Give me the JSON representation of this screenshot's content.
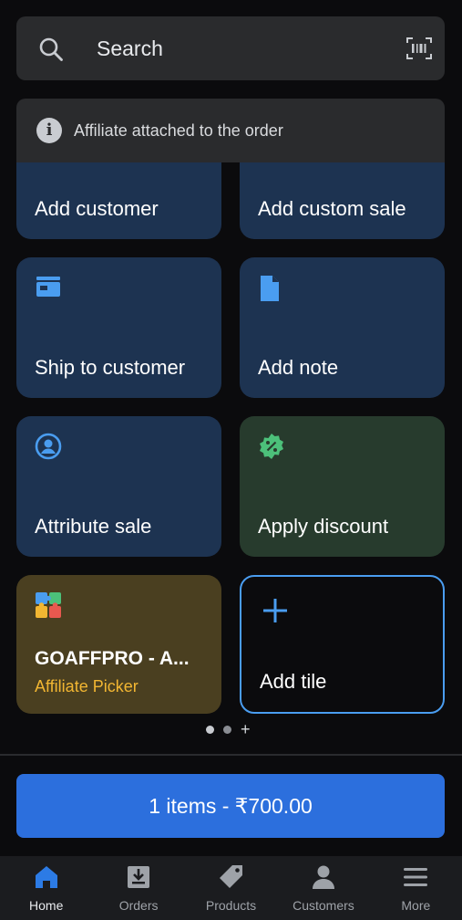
{
  "search": {
    "label": "Search",
    "icon": "search-icon",
    "scan_icon": "barcode-scan-icon"
  },
  "banner": {
    "text": "Affiliate attached to the order",
    "icon": "info-icon"
  },
  "tiles": {
    "add_customer": {
      "label": "Add customer"
    },
    "add_custom_sale": {
      "label": "Add custom sale"
    },
    "ship_to_customer": {
      "label": "Ship to customer",
      "icon": "store-icon"
    },
    "add_note": {
      "label": "Add note",
      "icon": "note-icon"
    },
    "attribute_sale": {
      "label": "Attribute sale",
      "icon": "user-circle-icon"
    },
    "apply_discount": {
      "label": "Apply discount",
      "icon": "discount-badge-icon"
    },
    "goaffpro": {
      "title": "GOAFFPRO - A...",
      "subtitle": "Affiliate Picker",
      "icon": "puzzle-app-icon"
    },
    "add_tile": {
      "label": "Add tile",
      "icon": "plus-icon"
    }
  },
  "pagination": {
    "pages": 2,
    "current": 1,
    "add_symbol": "+"
  },
  "checkout": {
    "label": "1 items - ₹700.00"
  },
  "tabbar": {
    "items": [
      {
        "label": "Home",
        "icon": "home-icon",
        "active": true
      },
      {
        "label": "Orders",
        "icon": "orders-icon",
        "active": false
      },
      {
        "label": "Products",
        "icon": "tag-icon",
        "active": false
      },
      {
        "label": "Customers",
        "icon": "person-icon",
        "active": false
      },
      {
        "label": "More",
        "icon": "menu-icon",
        "active": false
      }
    ]
  },
  "colors": {
    "background": "#0b0b0d",
    "tile_blue": "#1d3351",
    "tile_green": "#273b2d",
    "tile_olive": "#4a3f20",
    "accent": "#2c6fdd",
    "icon_blue": "#4a9df0",
    "icon_green": "#4cc07a",
    "subtitle_yellow": "#f2b632"
  }
}
